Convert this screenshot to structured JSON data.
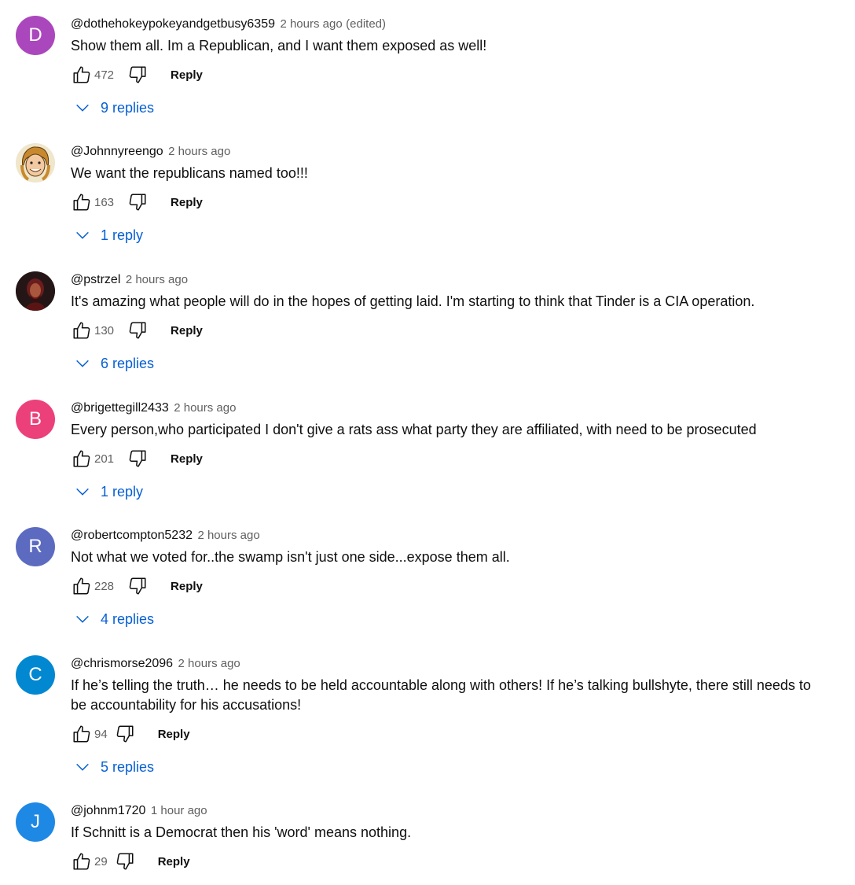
{
  "comments": [
    {
      "avatar_letter": "D",
      "avatar_color": "#ab47bc",
      "author": "@dothehokeypokeyandgetbusy6359",
      "time": "2 hours ago",
      "edited": "(edited)",
      "text": "Show them all. Im a Republican, and I want them exposed as well!",
      "likes": "472",
      "reply_label": "Reply",
      "replies_label": "9 replies"
    },
    {
      "avatar_letter": "",
      "avatar_color": "#d9c9a3",
      "author": "@Johnnyreengo",
      "time": "2 hours ago",
      "edited": "",
      "text": "We want the republicans named too!!!",
      "likes": "163",
      "reply_label": "Reply",
      "replies_label": "1 reply"
    },
    {
      "avatar_letter": "",
      "avatar_color": "#2a1a1a",
      "author": "@pstrzel",
      "time": "2 hours ago",
      "edited": "",
      "text": "It's amazing what people will do in the hopes of getting laid. I'm starting to think that Tinder is a CIA operation.",
      "likes": "130",
      "reply_label": "Reply",
      "replies_label": "6 replies"
    },
    {
      "avatar_letter": "B",
      "avatar_color": "#ec407a",
      "author": "@brigettegill2433",
      "time": "2 hours ago",
      "edited": "",
      "text": "Every person,who participated I don't give a rats ass what party they are affiliated, with need to be prosecuted",
      "likes": "201",
      "reply_label": "Reply",
      "replies_label": "1 reply"
    },
    {
      "avatar_letter": "R",
      "avatar_color": "#5c6bc0",
      "author": "@robertcompton5232",
      "time": "2 hours ago",
      "edited": "",
      "text": "Not what we voted for..the swamp isn't just one side...expose them all.",
      "likes": "228",
      "reply_label": "Reply",
      "replies_label": "4 replies"
    },
    {
      "avatar_letter": "C",
      "avatar_color": "#0288d1",
      "author": "@chrismorse2096",
      "time": "2 hours ago",
      "edited": "",
      "text": "If he’s telling the truth… he needs to be held accountable along with others! If he’s talking bullshyte, there still needs to be accountability for his accusations!",
      "likes": "94",
      "reply_label": "Reply",
      "replies_label": "5 replies"
    },
    {
      "avatar_letter": "J",
      "avatar_color": "#1e88e5",
      "author": "@johnm1720",
      "time": "1 hour ago",
      "edited": "",
      "text": "If Schnitt is a Democrat then his 'word' means nothing.",
      "likes": "29",
      "reply_label": "Reply",
      "replies_label": ""
    }
  ],
  "colors": {
    "link_blue": "#065fd4",
    "meta_gray": "#606060"
  },
  "icons": {
    "like": "thumbs-up-icon",
    "dislike": "thumbs-down-icon",
    "expand": "chevron-down-icon"
  }
}
